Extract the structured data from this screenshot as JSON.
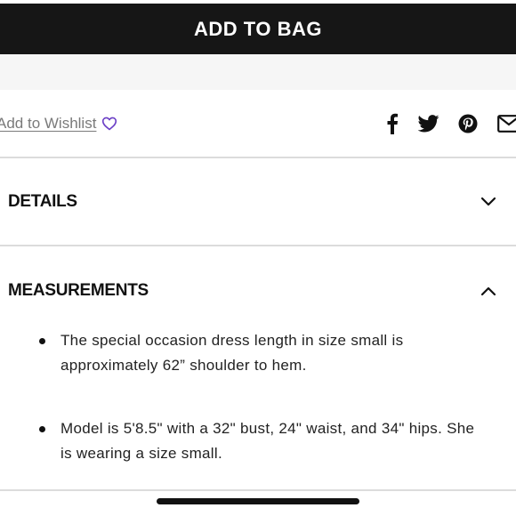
{
  "cart": {
    "add_to_bag_label": "ADD TO BAG"
  },
  "wishlist": {
    "label": "Add to Wishlist",
    "icon": "heart-outline-icon",
    "icon_color": "#6b3fc6"
  },
  "share": {
    "icons": [
      "facebook-icon",
      "twitter-icon",
      "pinterest-icon",
      "email-icon"
    ]
  },
  "accordion": {
    "details": {
      "title": "DETAILS",
      "state": "collapsed",
      "icon": "chevron-down-icon"
    },
    "measurements": {
      "title": "MEASUREMENTS",
      "state": "expanded",
      "icon": "chevron-up-icon",
      "items": [
        "The special occasion dress length in size small is approximately 62” shoulder to hem.",
        "Model is 5'8.5\" with a 32\" bust, 24\" waist, and 34\" hips. She is wearing a size small."
      ]
    }
  },
  "colors": {
    "button_bg": "#161616",
    "divider": "#dcdcdc",
    "band": "#f6f6f6"
  }
}
